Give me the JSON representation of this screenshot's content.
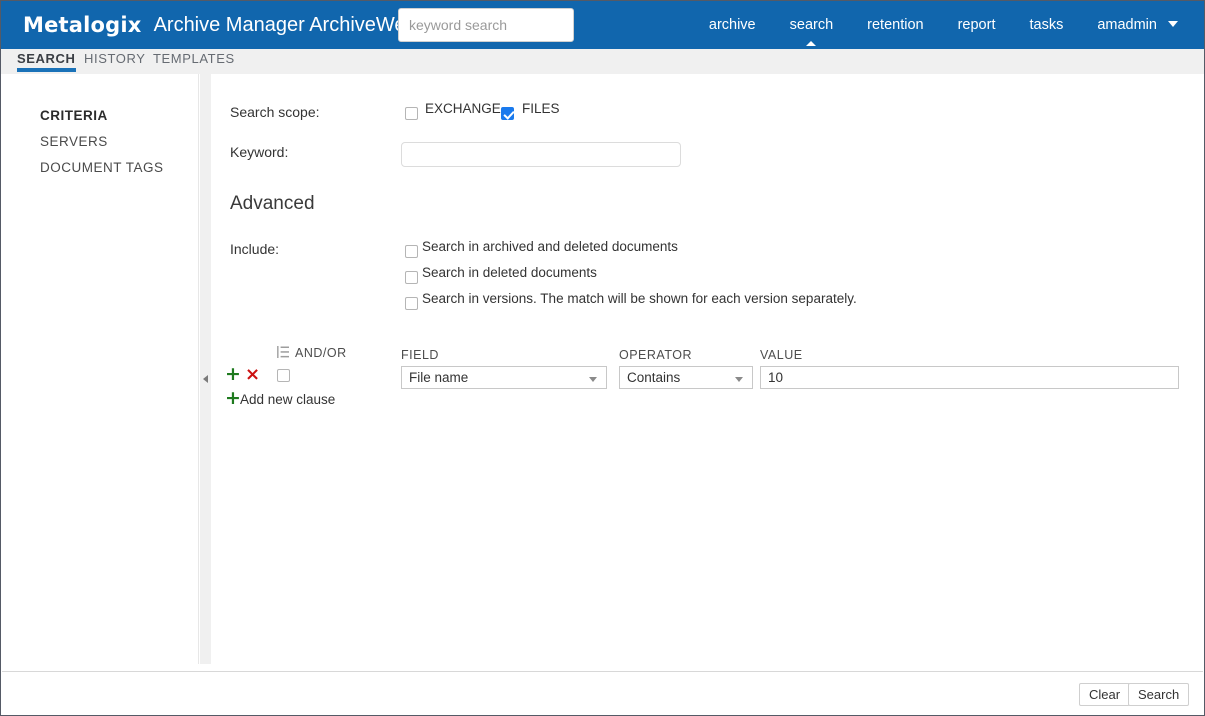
{
  "header": {
    "brand": "Metalogix",
    "app_title": "Archive Manager ArchiveWeb",
    "search_placeholder": "keyword search",
    "search_value": "",
    "nav": [
      {
        "label": "archive",
        "active": false
      },
      {
        "label": "search",
        "active": true
      },
      {
        "label": "retention",
        "active": false
      },
      {
        "label": "report",
        "active": false
      },
      {
        "label": "tasks",
        "active": false
      }
    ],
    "user": "amadmin",
    "brand_color": "#1166ad"
  },
  "tabs": [
    {
      "label": "SEARCH",
      "active": true
    },
    {
      "label": "HISTORY",
      "active": false
    },
    {
      "label": "TEMPLATES",
      "active": false
    }
  ],
  "sidebar": {
    "items": [
      {
        "label": "CRITERIA",
        "active": true
      },
      {
        "label": "SERVERS",
        "active": false
      },
      {
        "label": "DOCUMENT TAGS",
        "active": false
      }
    ]
  },
  "form": {
    "scope_label": "Search scope:",
    "scope_options": [
      {
        "label": "EXCHANGE",
        "checked": false
      },
      {
        "label": "FILES",
        "checked": true
      }
    ],
    "keyword_label": "Keyword:",
    "keyword_value": "",
    "keyword_placeholder": "",
    "advanced_title": "Advanced",
    "include_label": "Include:",
    "include_options": [
      {
        "label": "Search in archived and deleted documents",
        "checked": false
      },
      {
        "label": "Search in deleted documents",
        "checked": false
      },
      {
        "label": "Search in versions. The match will be shown for each version separately.",
        "checked": false
      }
    ]
  },
  "clause_builder": {
    "columns": {
      "andor": "AND/OR",
      "field": "FIELD",
      "operator": "OPERATOR",
      "value": "VALUE"
    },
    "row": {
      "andor_checked": false,
      "field_value": "File name",
      "operator_value": "Contains",
      "value_value": "10"
    },
    "add_label": "Add new clause",
    "plus_glyph": "+",
    "remove_glyph": "×",
    "plus_color": "#1e7a1e",
    "remove_color": "#cc1111"
  },
  "footer": {
    "clear_label": "Clear",
    "search_label": "Search"
  }
}
